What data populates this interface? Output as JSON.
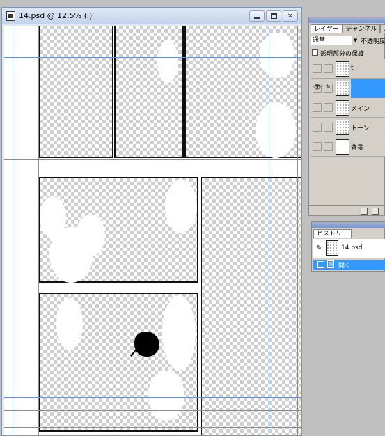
{
  "document": {
    "title": "14.psd @ 12.5% (l)",
    "window_buttons": {
      "minimize": "minimize",
      "maximize": "maximize",
      "close": "close"
    }
  },
  "layers_palette": {
    "tabs": [
      "レイヤー",
      "チャンネル",
      "パ"
    ],
    "blend_mode": "通常",
    "opacity_label": "不透明度",
    "lock_label": "透明部分の保護",
    "layers": [
      {
        "name": "t",
        "selected": false
      },
      {
        "name": "l",
        "selected": true
      },
      {
        "name": "メイン",
        "selected": false
      },
      {
        "name": "トーン",
        "selected": false
      },
      {
        "name": "背景",
        "selected": false
      }
    ]
  },
  "history_palette": {
    "tab": "ヒストリー",
    "snapshot": "14.psd",
    "items": [
      "開く"
    ]
  },
  "colors": {
    "selection": "#3399ff",
    "guide": "#6f8fd6"
  }
}
